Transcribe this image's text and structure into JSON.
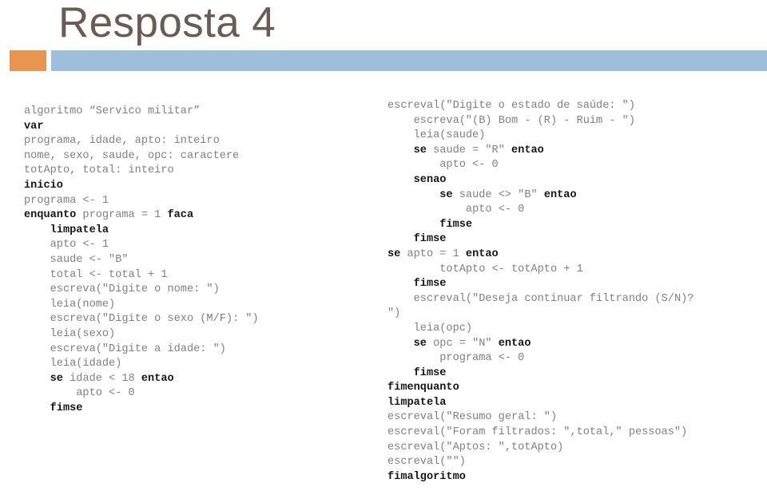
{
  "slide": {
    "title": "Resposta 4",
    "title_color": "#6b5b53",
    "accent_square_color": "#e8954f",
    "accent_bar_color": "#9dbfdb",
    "code_text_color": "#808080",
    "code_keyword_color": "#161616"
  },
  "code": {
    "indent_unit_chars": 4,
    "left_column": [
      {
        "indent": 0,
        "segments": [
          {
            "text": "algoritmo “Servico militar”",
            "kw": false
          }
        ]
      },
      {
        "indent": 0,
        "segments": [
          {
            "text": "var",
            "kw": true
          }
        ]
      },
      {
        "indent": 0,
        "segments": [
          {
            "text": "programa, idade, apto: inteiro",
            "kw": false
          }
        ]
      },
      {
        "indent": 0,
        "segments": [
          {
            "text": "nome, sexo, saude, opc: caractere",
            "kw": false
          }
        ]
      },
      {
        "indent": 0,
        "segments": [
          {
            "text": "totApto, total: inteiro",
            "kw": false
          }
        ]
      },
      {
        "indent": 0,
        "segments": [
          {
            "text": "inicio",
            "kw": true
          }
        ]
      },
      {
        "indent": 0,
        "segments": [
          {
            "text": "programa <- 1",
            "kw": false
          }
        ]
      },
      {
        "indent": 0,
        "segments": [
          {
            "text": "enquanto ",
            "kw": true
          },
          {
            "text": "programa = 1 ",
            "kw": false
          },
          {
            "text": "faca",
            "kw": true
          }
        ]
      },
      {
        "indent": 1,
        "segments": [
          {
            "text": "limpatela",
            "kw": true
          }
        ]
      },
      {
        "indent": 1,
        "segments": [
          {
            "text": "apto <- 1",
            "kw": false
          }
        ]
      },
      {
        "indent": 1,
        "segments": [
          {
            "text": "saude <- \"B\"",
            "kw": false
          }
        ]
      },
      {
        "indent": 1,
        "segments": [
          {
            "text": "total <- total + 1",
            "kw": false
          }
        ]
      },
      {
        "indent": 1,
        "segments": [
          {
            "text": "escreva(\"Digite o nome: \")",
            "kw": false
          }
        ]
      },
      {
        "indent": 1,
        "segments": [
          {
            "text": "leia(nome)",
            "kw": false
          }
        ]
      },
      {
        "indent": 1,
        "segments": [
          {
            "text": "escreva(\"Digite o sexo (M/F): \")",
            "kw": false
          }
        ]
      },
      {
        "indent": 1,
        "segments": [
          {
            "text": "leia(sexo)",
            "kw": false
          }
        ]
      },
      {
        "indent": 1,
        "segments": [
          {
            "text": "escreva(\"Digite a idade: \")",
            "kw": false
          }
        ]
      },
      {
        "indent": 1,
        "segments": [
          {
            "text": "leia(idade)",
            "kw": false
          }
        ]
      },
      {
        "indent": 1,
        "segments": [
          {
            "text": "se ",
            "kw": true
          },
          {
            "text": "idade < 18 ",
            "kw": false
          },
          {
            "text": "entao",
            "kw": true
          }
        ]
      },
      {
        "indent": 2,
        "segments": [
          {
            "text": "apto <- 0",
            "kw": false
          }
        ]
      },
      {
        "indent": 1,
        "segments": [
          {
            "text": "fimse",
            "kw": true
          }
        ]
      }
    ],
    "right_column": [
      {
        "indent": 0,
        "segments": [
          {
            "text": "escreval(\"Digite o estado de saúde: \")",
            "kw": false
          }
        ]
      },
      {
        "indent": 1,
        "segments": [
          {
            "text": "escreva(\"(B) Bom - (R) - Ruim - \")",
            "kw": false
          }
        ]
      },
      {
        "indent": 1,
        "segments": [
          {
            "text": "leia(saude)",
            "kw": false
          }
        ]
      },
      {
        "indent": 1,
        "segments": [
          {
            "text": "se ",
            "kw": true
          },
          {
            "text": "saude = \"R\" ",
            "kw": false
          },
          {
            "text": "entao",
            "kw": true
          }
        ]
      },
      {
        "indent": 2,
        "segments": [
          {
            "text": "apto <- 0",
            "kw": false
          }
        ]
      },
      {
        "indent": 1,
        "segments": [
          {
            "text": "senao",
            "kw": true
          }
        ]
      },
      {
        "indent": 2,
        "segments": [
          {
            "text": "se ",
            "kw": true
          },
          {
            "text": "saude <> \"B\" ",
            "kw": false
          },
          {
            "text": "entao",
            "kw": true
          }
        ]
      },
      {
        "indent": 3,
        "segments": [
          {
            "text": "apto <- 0",
            "kw": false
          }
        ]
      },
      {
        "indent": 2,
        "segments": [
          {
            "text": "fimse",
            "kw": true
          }
        ]
      },
      {
        "indent": 1,
        "segments": [
          {
            "text": "fimse",
            "kw": true
          }
        ]
      },
      {
        "indent": 0,
        "segments": [
          {
            "text": "se ",
            "kw": true
          },
          {
            "text": "apto = 1 ",
            "kw": false
          },
          {
            "text": "entao",
            "kw": true
          }
        ]
      },
      {
        "indent": 2,
        "segments": [
          {
            "text": "totApto <- totApto + 1",
            "kw": false
          }
        ]
      },
      {
        "indent": 1,
        "segments": [
          {
            "text": "fimse",
            "kw": true
          }
        ]
      },
      {
        "indent": 1,
        "segments": [
          {
            "text": "escreval(\"Deseja continuar filtrando (S/N)?",
            "kw": false
          }
        ]
      },
      {
        "indent": 0,
        "segments": [
          {
            "text": "\")",
            "kw": false
          }
        ]
      },
      {
        "indent": 1,
        "segments": [
          {
            "text": "leia(opc)",
            "kw": false
          }
        ]
      },
      {
        "indent": 1,
        "segments": [
          {
            "text": "se ",
            "kw": true
          },
          {
            "text": "opc = \"N\" ",
            "kw": false
          },
          {
            "text": "entao",
            "kw": true
          }
        ]
      },
      {
        "indent": 2,
        "segments": [
          {
            "text": "programa <- 0",
            "kw": false
          }
        ]
      },
      {
        "indent": 1,
        "segments": [
          {
            "text": "fimse",
            "kw": true
          }
        ]
      },
      {
        "indent": 0,
        "segments": [
          {
            "text": "fimenquanto",
            "kw": true
          }
        ]
      },
      {
        "indent": 0,
        "segments": [
          {
            "text": "limpatela",
            "kw": true
          }
        ]
      },
      {
        "indent": 0,
        "segments": [
          {
            "text": "escreval(\"Resumo geral: \")",
            "kw": false
          }
        ]
      },
      {
        "indent": 0,
        "segments": [
          {
            "text": "escreval(\"Foram filtrados: \",total,\" pessoas\")",
            "kw": false
          }
        ]
      },
      {
        "indent": 0,
        "segments": [
          {
            "text": "escreval(\"Aptos: \",totApto)",
            "kw": false
          }
        ]
      },
      {
        "indent": 0,
        "segments": [
          {
            "text": "escreval(\"\")",
            "kw": false
          }
        ]
      },
      {
        "indent": 0,
        "segments": [
          {
            "text": "fimalgoritmo",
            "kw": true
          }
        ]
      }
    ]
  }
}
